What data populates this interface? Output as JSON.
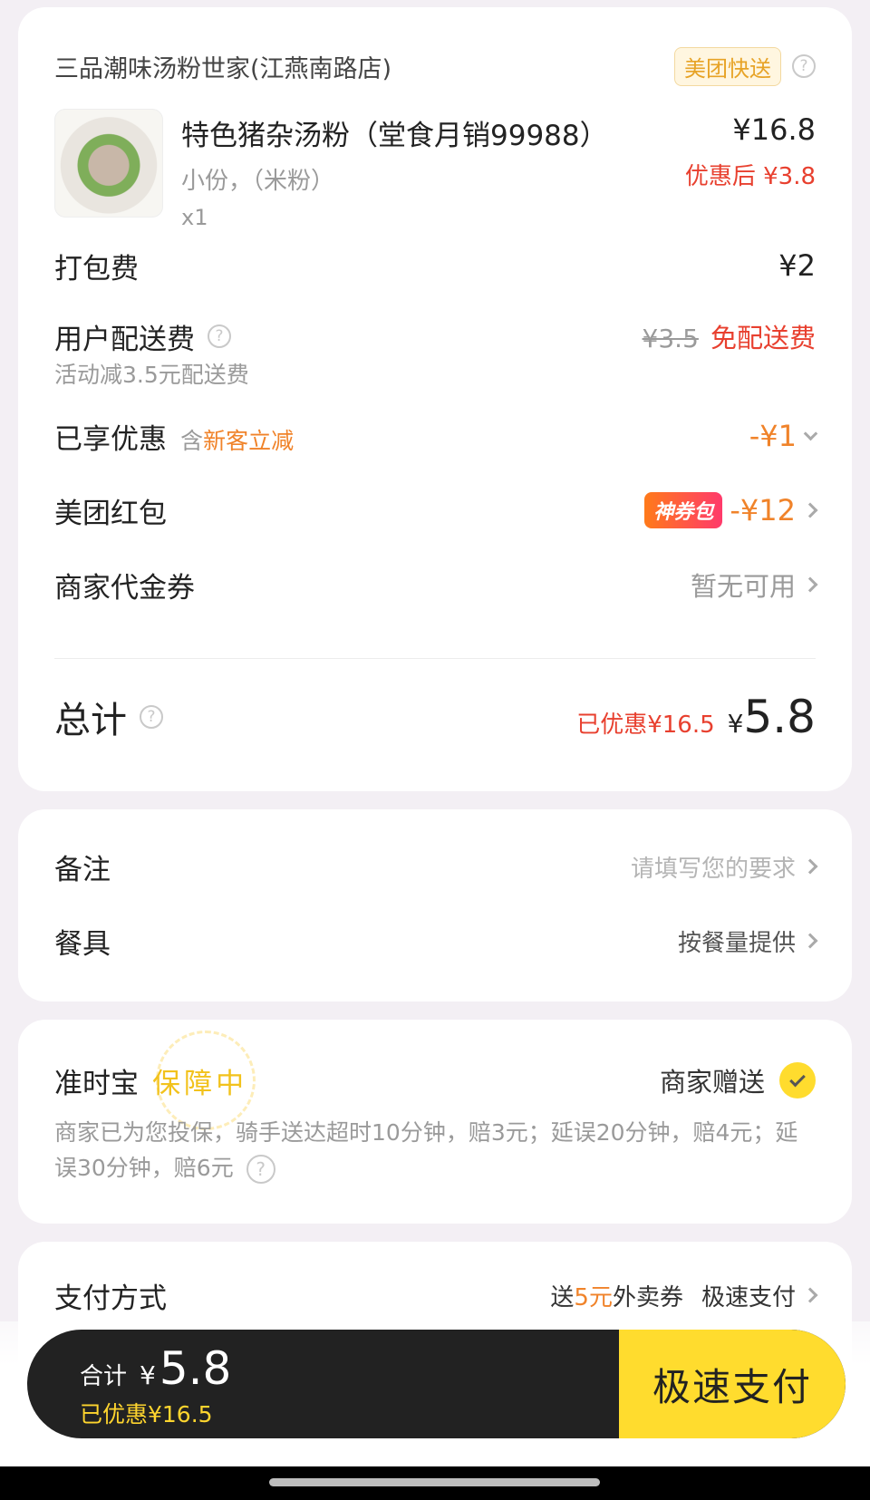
{
  "store": {
    "name": "三品潮味汤粉世家(江燕南路店)",
    "badge": "美团快送",
    "help": "?"
  },
  "item": {
    "name": "特色猪杂汤粉（堂食月销99988）",
    "spec": "小份，（米粉）",
    "qty": "x1",
    "price": "¥16.8",
    "discount_price": "优惠后 ¥3.8"
  },
  "packing_fee": {
    "label": "打包费",
    "value": "¥2"
  },
  "delivery_fee": {
    "label": "用户配送费",
    "sub": "活动减3.5元配送费",
    "original": "¥3.5",
    "value": "免配送费"
  },
  "enjoyed": {
    "label": "已享优惠",
    "prefix": "含",
    "highlight": "新客立减",
    "value": "-¥1"
  },
  "red_packet": {
    "label": "美团红包",
    "badge": "神券包",
    "value": "-¥12"
  },
  "voucher": {
    "label": "商家代金券",
    "value": "暂无可用"
  },
  "total": {
    "label": "总计",
    "saved": "已优惠¥16.5",
    "symbol": "¥",
    "value": "5.8"
  },
  "notes": {
    "remark_label": "备注",
    "remark_placeholder": "请填写您的要求",
    "utensils_label": "餐具",
    "utensils_value": "按餐量提供"
  },
  "ontime": {
    "title": "准时宝",
    "status": "保障中",
    "gift": "商家赠送",
    "desc": "商家已为您投保，骑手送达超时10分钟，赔3元；延误20分钟，赔4元；延误30分钟，赔6元"
  },
  "payment": {
    "label": "支付方式",
    "promo_prefix": "送",
    "promo_amount": "5元",
    "promo_suffix": "外卖券",
    "method": "极速支付"
  },
  "bottom_bar": {
    "total_label": "合计",
    "symbol": "¥",
    "total": "5.8",
    "saved": "已优惠¥16.5",
    "pay_button": "极速支付"
  },
  "colors": {
    "accent_red": "#e8402f",
    "accent_orange": "#f0832a",
    "pay_yellow": "#ffdc2e",
    "bar_dark": "#222222"
  }
}
